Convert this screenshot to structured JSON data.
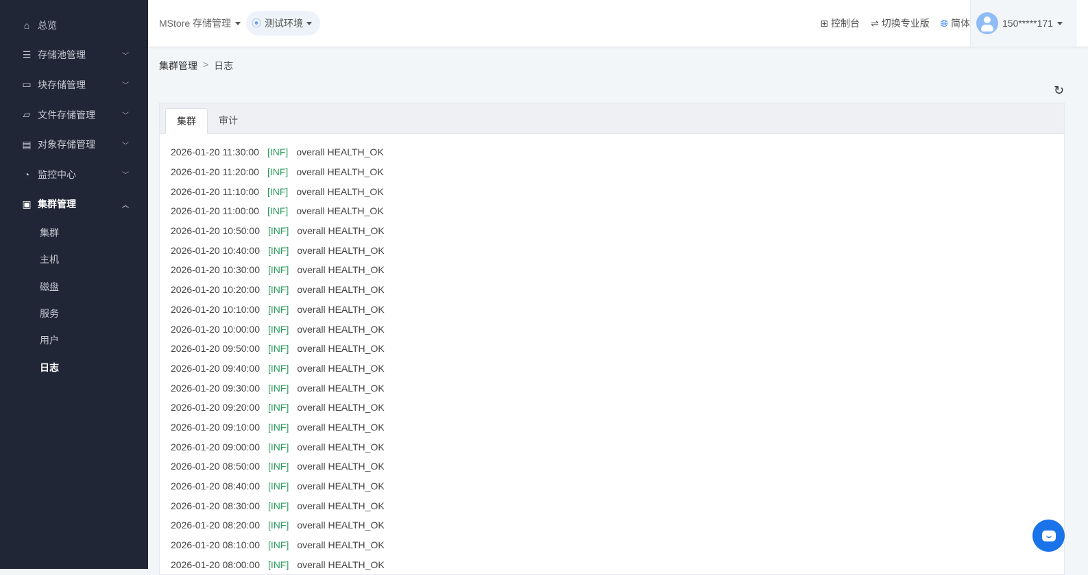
{
  "sidebar": {
    "items": [
      {
        "label": "总览",
        "icon": "home-icon"
      },
      {
        "label": "存储池管理",
        "icon": "server-icon"
      },
      {
        "label": "块存储管理",
        "icon": "block-icon"
      },
      {
        "label": "文件存储管理",
        "icon": "folder-icon"
      },
      {
        "label": "对象存储管理",
        "icon": "object-icon"
      },
      {
        "label": "监控中心",
        "icon": "dashboard-icon"
      },
      {
        "label": "集群管理",
        "icon": "cluster-icon"
      }
    ],
    "sub_items": [
      "集群",
      "主机",
      "磁盘",
      "服务",
      "用户",
      "日志"
    ]
  },
  "header": {
    "brand": "MStore 存储管理",
    "env": "测试环境",
    "console": "控制台",
    "switch": "切换专业版",
    "lang": "简体",
    "user": "150*****171"
  },
  "breadcrumb": {
    "parent": "集群管理",
    "sep": ">",
    "current": "日志"
  },
  "tabs": [
    "集群",
    "审计"
  ],
  "logs": [
    [
      "2026-01-20 11:30:00",
      "[INF]",
      "overall HEALTH_OK"
    ],
    [
      "2026-01-20 11:20:00",
      "[INF]",
      "overall HEALTH_OK"
    ],
    [
      "2026-01-20 11:10:00",
      "[INF]",
      "overall HEALTH_OK"
    ],
    [
      "2026-01-20 11:00:00",
      "[INF]",
      "overall HEALTH_OK"
    ],
    [
      "2026-01-20 10:50:00",
      "[INF]",
      "overall HEALTH_OK"
    ],
    [
      "2026-01-20 10:40:00",
      "[INF]",
      "overall HEALTH_OK"
    ],
    [
      "2026-01-20 10:30:00",
      "[INF]",
      "overall HEALTH_OK"
    ],
    [
      "2026-01-20 10:20:00",
      "[INF]",
      "overall HEALTH_OK"
    ],
    [
      "2026-01-20 10:10:00",
      "[INF]",
      "overall HEALTH_OK"
    ],
    [
      "2026-01-20 10:00:00",
      "[INF]",
      "overall HEALTH_OK"
    ],
    [
      "2026-01-20 09:50:00",
      "[INF]",
      "overall HEALTH_OK"
    ],
    [
      "2026-01-20 09:40:00",
      "[INF]",
      "overall HEALTH_OK"
    ],
    [
      "2026-01-20 09:30:00",
      "[INF]",
      "overall HEALTH_OK"
    ],
    [
      "2026-01-20 09:20:00",
      "[INF]",
      "overall HEALTH_OK"
    ],
    [
      "2026-01-20 09:10:00",
      "[INF]",
      "overall HEALTH_OK"
    ],
    [
      "2026-01-20 09:00:00",
      "[INF]",
      "overall HEALTH_OK"
    ],
    [
      "2026-01-20 08:50:00",
      "[INF]",
      "overall HEALTH_OK"
    ],
    [
      "2026-01-20 08:40:00",
      "[INF]",
      "overall HEALTH_OK"
    ],
    [
      "2026-01-20 08:30:00",
      "[INF]",
      "overall HEALTH_OK"
    ],
    [
      "2026-01-20 08:20:00",
      "[INF]",
      "overall HEALTH_OK"
    ],
    [
      "2026-01-20 08:10:00",
      "[INF]",
      "overall HEALTH_OK"
    ],
    [
      "2026-01-20 08:00:00",
      "[INF]",
      "overall HEALTH_OK"
    ]
  ]
}
